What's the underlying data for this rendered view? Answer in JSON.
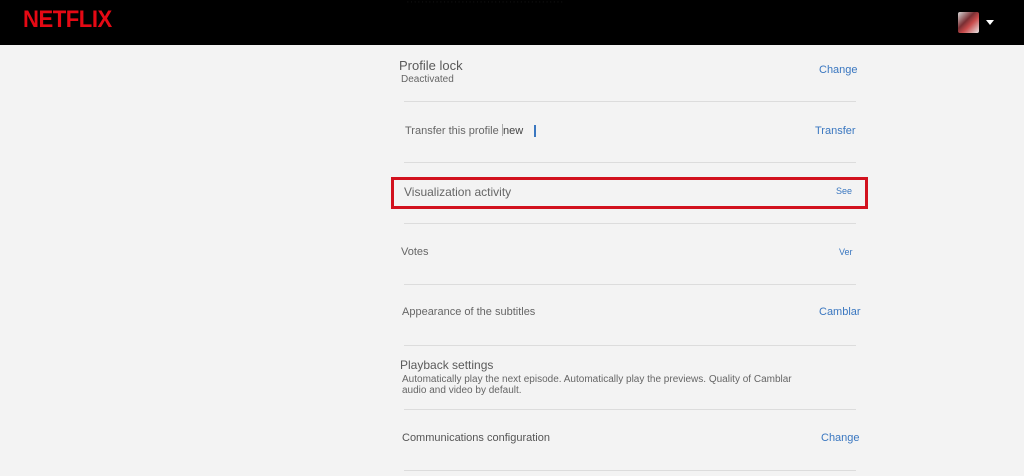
{
  "header": {
    "logo": "NETFLIX",
    "ghost_text": "···········································"
  },
  "rows": {
    "profile_lock": {
      "title": "Profile lock",
      "status": "Deactivated",
      "action": "Change"
    },
    "transfer": {
      "title": "Transfer this profile",
      "tag": "new",
      "action": "Transfer"
    },
    "visualization": {
      "title": "Visualization activity",
      "action": "See"
    },
    "votes": {
      "title": "Votes",
      "action": "Ver"
    },
    "subtitles": {
      "title": "Appearance of the subtitles",
      "action": "Camblar"
    },
    "playback": {
      "title": "Playback settings",
      "description_line1": "Automatically play the next episode. Automatically play the previews. Quality of Camblar",
      "description_line2": "audio and video by default."
    },
    "communications": {
      "title": "Communications configuration",
      "action": "Change"
    }
  },
  "colors": {
    "brand": "#e50914",
    "link": "#3a77c0",
    "highlight": "#d2111e"
  }
}
